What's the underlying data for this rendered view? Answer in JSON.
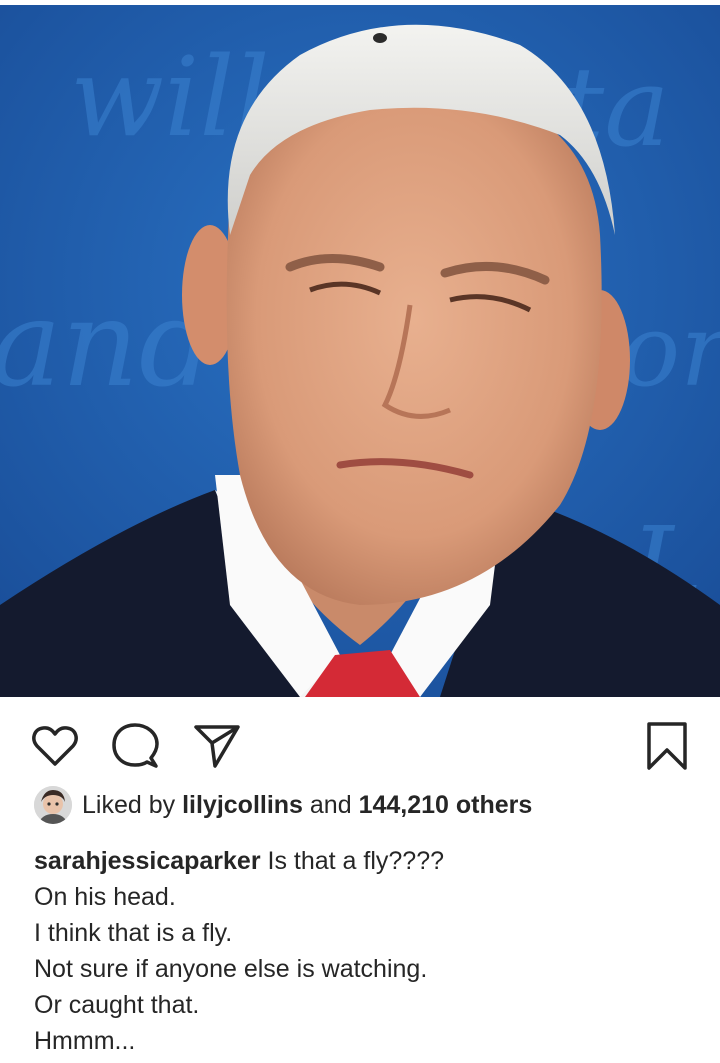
{
  "post": {
    "photo_alt": "Close-up photo of a man in a dark suit, white shirt and red tie with a fly on his white hair, in front of a blue backdrop",
    "backdrop_color": "#1f5fae",
    "actions": {
      "like_icon": "heart-icon",
      "comment_icon": "comment-icon",
      "share_icon": "paper-plane-icon",
      "save_icon": "bookmark-icon"
    },
    "likes": {
      "prefix": "Liked by",
      "user": "lilyjcollins",
      "joiner": "and",
      "count_text": "144,210 others"
    },
    "caption": {
      "username": "sarahjessicaparker",
      "first_line": "Is that a fly????",
      "lines": [
        "On his head.",
        "I think that is a fly.",
        "Not sure if anyone else is watching.",
        "Or caught that.",
        "Hmmm..."
      ]
    }
  }
}
